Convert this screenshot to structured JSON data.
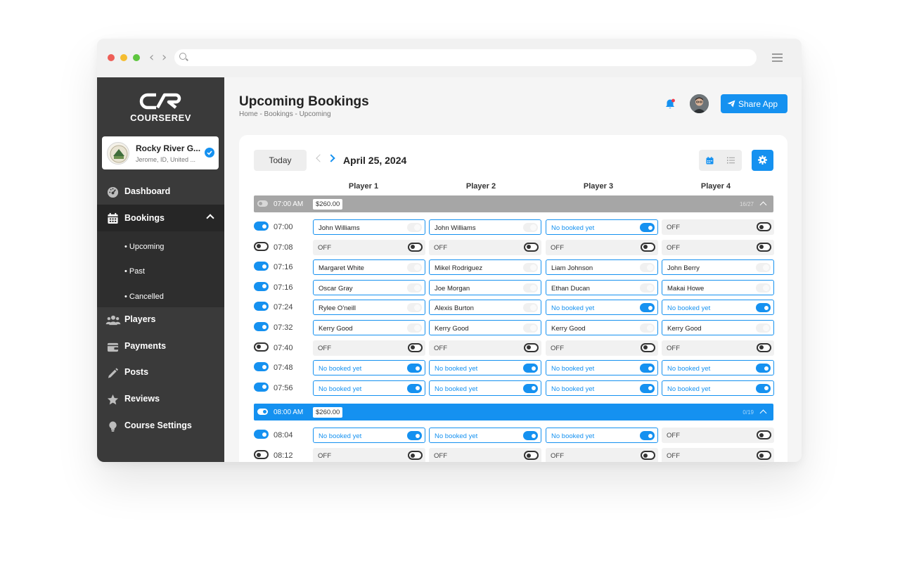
{
  "sidebar": {
    "logo_text": "COURSEREV",
    "course": {
      "name": "Rocky River G...",
      "location": "Jerome, ID, United ..."
    },
    "items": [
      {
        "label": "Dashboard",
        "icon": "dashboard-icon"
      },
      {
        "label": "Bookings",
        "icon": "calendar-icon"
      },
      {
        "label": "Players",
        "icon": "users-icon"
      },
      {
        "label": "Payments",
        "icon": "wallet-icon"
      },
      {
        "label": "Posts",
        "icon": "pencil-icon"
      },
      {
        "label": "Reviews",
        "icon": "star-icon"
      },
      {
        "label": "Course Settings",
        "icon": "lightbulb-icon"
      }
    ],
    "sub_items": [
      "• Upcoming",
      "• Past",
      "• Cancelled"
    ]
  },
  "header": {
    "title": "Upcoming Bookings",
    "breadcrumb": "Home - Bookings - Upcoming",
    "share_label": "Share App"
  },
  "toolbar": {
    "today_label": "Today",
    "date": "April 25, 2024"
  },
  "columns": [
    "Player 1",
    "Player 2",
    "Player 3",
    "Player 4"
  ],
  "groups": [
    {
      "time": "07:00 AM",
      "price": "$260.00",
      "count": "16/27",
      "state": "inactive",
      "slots": [
        {
          "time": "07:00",
          "on": true,
          "players": [
            {
              "text": "John Williams",
              "kind": "name"
            },
            {
              "text": "John Williams",
              "kind": "name"
            },
            {
              "text": "No booked yet",
              "kind": "open"
            },
            {
              "text": "OFF",
              "kind": "off"
            }
          ]
        },
        {
          "time": "07:08",
          "on": false,
          "players": [
            {
              "text": "OFF",
              "kind": "off"
            },
            {
              "text": "OFF",
              "kind": "off"
            },
            {
              "text": "OFF",
              "kind": "off"
            },
            {
              "text": "OFF",
              "kind": "off"
            }
          ]
        },
        {
          "time": "07:16",
          "on": true,
          "players": [
            {
              "text": "Margaret White",
              "kind": "name"
            },
            {
              "text": "Mikel Rodriguez",
              "kind": "name"
            },
            {
              "text": "Liam Johnson",
              "kind": "name"
            },
            {
              "text": "John Berry",
              "kind": "name"
            }
          ]
        },
        {
          "time": "07:16",
          "on": true,
          "players": [
            {
              "text": "Oscar Gray",
              "kind": "name"
            },
            {
              "text": "Joe Morgan",
              "kind": "name"
            },
            {
              "text": "Ethan Ducan",
              "kind": "name"
            },
            {
              "text": "Makai Howe",
              "kind": "name"
            }
          ]
        },
        {
          "time": "07:24",
          "on": true,
          "players": [
            {
              "text": "Rylee O'neill",
              "kind": "name"
            },
            {
              "text": "Alexis Burton",
              "kind": "name"
            },
            {
              "text": "No booked yet",
              "kind": "open"
            },
            {
              "text": "No booked yet",
              "kind": "open"
            }
          ]
        },
        {
          "time": "07:32",
          "on": true,
          "players": [
            {
              "text": "Kerry Good",
              "kind": "name"
            },
            {
              "text": "Kerry Good",
              "kind": "name"
            },
            {
              "text": "Kerry Good",
              "kind": "name"
            },
            {
              "text": "Kerry Good",
              "kind": "name"
            }
          ]
        },
        {
          "time": "07:40",
          "on": false,
          "players": [
            {
              "text": "OFF",
              "kind": "off"
            },
            {
              "text": "OFF",
              "kind": "off"
            },
            {
              "text": "OFF",
              "kind": "off"
            },
            {
              "text": "OFF",
              "kind": "off"
            }
          ]
        },
        {
          "time": "07:48",
          "on": true,
          "players": [
            {
              "text": "No booked yet",
              "kind": "open"
            },
            {
              "text": "No booked yet",
              "kind": "open"
            },
            {
              "text": "No booked yet",
              "kind": "open"
            },
            {
              "text": "No booked yet",
              "kind": "open"
            }
          ]
        },
        {
          "time": "07:56",
          "on": true,
          "players": [
            {
              "text": "No booked yet",
              "kind": "open"
            },
            {
              "text": "No booked yet",
              "kind": "open"
            },
            {
              "text": "No booked yet",
              "kind": "open"
            },
            {
              "text": "No booked yet",
              "kind": "open"
            }
          ]
        }
      ]
    },
    {
      "time": "08:00 AM",
      "price": "$260.00",
      "count": "0/19",
      "state": "active",
      "slots": [
        {
          "time": "08:04",
          "on": true,
          "players": [
            {
              "text": "No booked yet",
              "kind": "open"
            },
            {
              "text": "No booked yet",
              "kind": "open"
            },
            {
              "text": "No booked yet",
              "kind": "open"
            },
            {
              "text": "OFF",
              "kind": "off"
            }
          ]
        },
        {
          "time": "08:12",
          "on": false,
          "players": [
            {
              "text": "OFF",
              "kind": "off"
            },
            {
              "text": "OFF",
              "kind": "off"
            },
            {
              "text": "OFF",
              "kind": "off"
            },
            {
              "text": "OFF",
              "kind": "off"
            }
          ]
        }
      ]
    }
  ]
}
